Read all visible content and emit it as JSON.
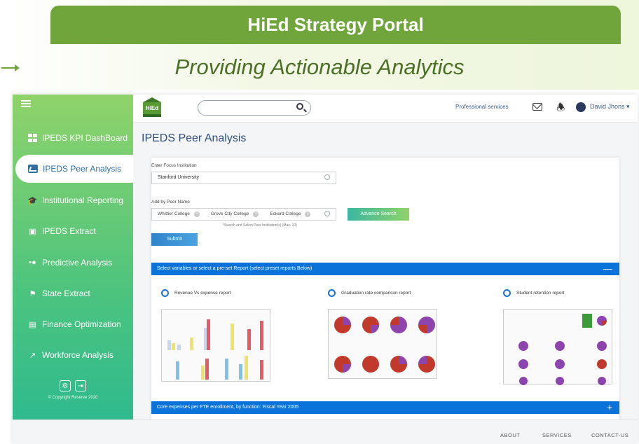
{
  "banner": {
    "title": "HiEd Strategy Portal",
    "subtitle": "Providing Actionable Analytics"
  },
  "sidebar": {
    "items": [
      {
        "label": "IPEDS KPI DashBoard",
        "icon": "dashboard-icon"
      },
      {
        "label": "IPEDS Peer Analysis",
        "icon": "chart-icon",
        "active": true
      },
      {
        "label": "Institutional Reporting",
        "icon": "graduation-cap-icon"
      },
      {
        "label": "IPEDS Extract",
        "icon": "extract-icon"
      },
      {
        "label": "Predictive Analysis",
        "icon": "predictive-icon"
      },
      {
        "label": "State Extract",
        "icon": "flag-icon"
      },
      {
        "label": "Finance Optimization",
        "icon": "finance-icon"
      },
      {
        "label": "Workforce Analysis",
        "icon": "workforce-icon"
      }
    ],
    "copyright": "© Copyright Reserve 2020"
  },
  "topbar": {
    "logo_text": "HiEd",
    "search_placeholder": "",
    "professional_services": "Professional services",
    "user_name": "David Jhons ▾"
  },
  "main": {
    "page_title": "IPEDS Peer Analysis",
    "focus_label": "Enter Focus Institution",
    "focus_value": "Stanford University",
    "peer_label": "Add by Peer Name",
    "peers": [
      "Whittier College",
      "Grove City College",
      "Eckerd College"
    ],
    "advance_search": "Advance Search",
    "peer_note": "*Search and Select Peer Institution(s) (Max. 10)",
    "submit": "Submit",
    "preset_bar": "Select variables or select a pre-set Report (select preset reports Below)",
    "preset_bar_symbol": "—",
    "reports": [
      "Revenue Vs expense report",
      "Graduation rate comparison report",
      "Student retention report"
    ],
    "expenses_bar": "Core expenses per FTE enrollment, by function: Fiscal Year 2005",
    "expenses_bar_symbol": "+"
  },
  "footer": {
    "about": "ABOUT",
    "services": "SERVICES",
    "contact": "CONTACT-US"
  },
  "colors": {
    "brand_green": "#6fa53a",
    "accent_blue": "#0a73d9",
    "title_blue": "#2e4f7a"
  }
}
